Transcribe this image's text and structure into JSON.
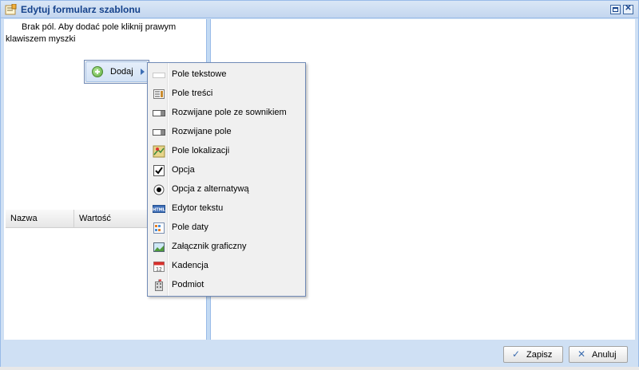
{
  "window": {
    "title": "Edytuj formularz szablonu",
    "title_icon": "form-edit-icon",
    "tools": [
      "maximize-icon",
      "close-icon"
    ]
  },
  "left_pane": {
    "info_text": "Brak pól. Aby dodać pole kliknij prawym klawiszem myszki"
  },
  "grid": {
    "columns": [
      "Nazwa",
      "Wartość"
    ]
  },
  "context_menu": {
    "item_label": "Dodaj",
    "item_icon": "add-icon"
  },
  "submenu": {
    "items": [
      {
        "label": "Pole tekstowe",
        "icon": "text-field-icon"
      },
      {
        "label": "Pole treści",
        "icon": "content-field-icon"
      },
      {
        "label": "Rozwijane pole ze sownikiem",
        "icon": "dropdown-dictionary-icon"
      },
      {
        "label": "Rozwijane pole",
        "icon": "dropdown-icon"
      },
      {
        "label": "Pole lokalizacji",
        "icon": "location-icon"
      },
      {
        "label": "Opcja",
        "icon": "checkbox-icon"
      },
      {
        "label": "Opcja z alternatywą",
        "icon": "radio-icon"
      },
      {
        "label": "Edytor tekstu",
        "icon": "html-editor-icon"
      },
      {
        "label": "Pole daty",
        "icon": "date-field-icon"
      },
      {
        "label": "Załącznik graficzny",
        "icon": "image-attachment-icon"
      },
      {
        "label": "Kadencja",
        "icon": "calendar-icon"
      },
      {
        "label": "Podmiot",
        "icon": "building-icon"
      }
    ]
  },
  "footer": {
    "save_label": "Zapisz",
    "cancel_label": "Anuluj"
  },
  "colors": {
    "frame": "#cfe0f4",
    "title_text": "#15428b",
    "menu_border": "#718bb7"
  }
}
